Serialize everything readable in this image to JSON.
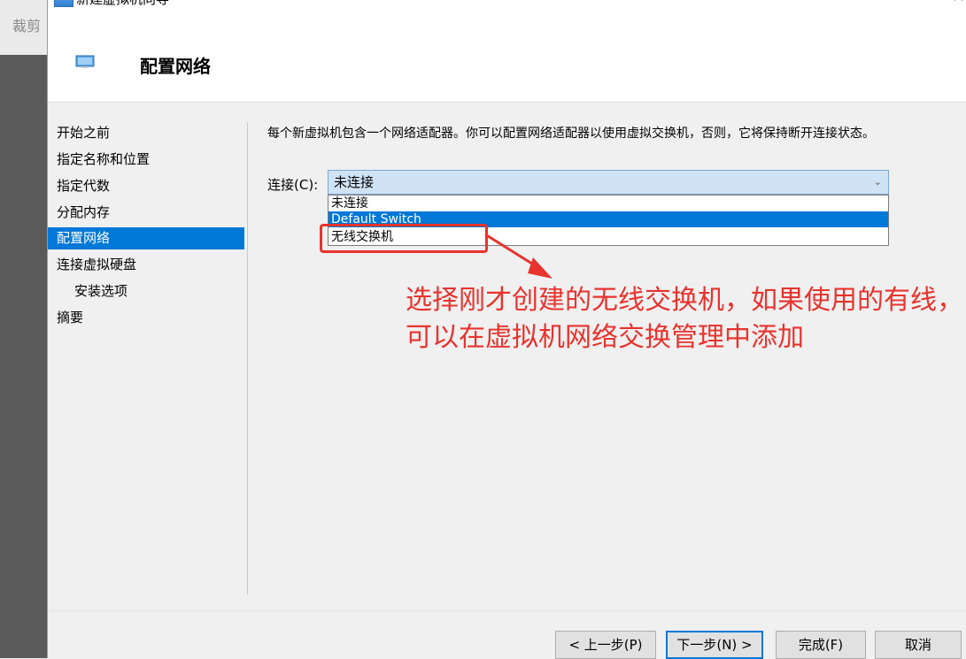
{
  "window": {
    "title": "新建虚拟机向导",
    "background_label": "裁剪"
  },
  "header": {
    "title": "配置网络"
  },
  "sidebar": {
    "items": [
      {
        "label": "开始之前",
        "active": false,
        "sub": false
      },
      {
        "label": "指定名称和位置",
        "active": false,
        "sub": false
      },
      {
        "label": "指定代数",
        "active": false,
        "sub": false
      },
      {
        "label": "分配内存",
        "active": false,
        "sub": false
      },
      {
        "label": "配置网络",
        "active": true,
        "sub": false
      },
      {
        "label": "连接虚拟硬盘",
        "active": false,
        "sub": false
      },
      {
        "label": "安装选项",
        "active": false,
        "sub": true
      },
      {
        "label": "摘要",
        "active": false,
        "sub": false
      }
    ]
  },
  "main": {
    "description": "每个新虚拟机包含一个网络适配器。你可以配置网络适配器以使用虚拟交换机，否则，它将保持断开连接状态。",
    "connection_label": "连接(C):",
    "connection_value": "未连接",
    "options": [
      {
        "label": "未连接",
        "selected": false
      },
      {
        "label": "Default Switch",
        "selected": true
      },
      {
        "label": "无线交换机",
        "selected": false
      }
    ]
  },
  "annotation": {
    "text": "选择刚才创建的无线交换机，如果使用的有线，可以在虚拟机网络交换管理中添加",
    "color": "#e8332e"
  },
  "footer": {
    "prev_label": "< 上一步(P)",
    "next_label": "下一步(N) >",
    "finish_label": "完成(F)",
    "cancel_label": "取消"
  },
  "colors": {
    "accent": "#0078d7",
    "annotation": "#e8332e"
  }
}
